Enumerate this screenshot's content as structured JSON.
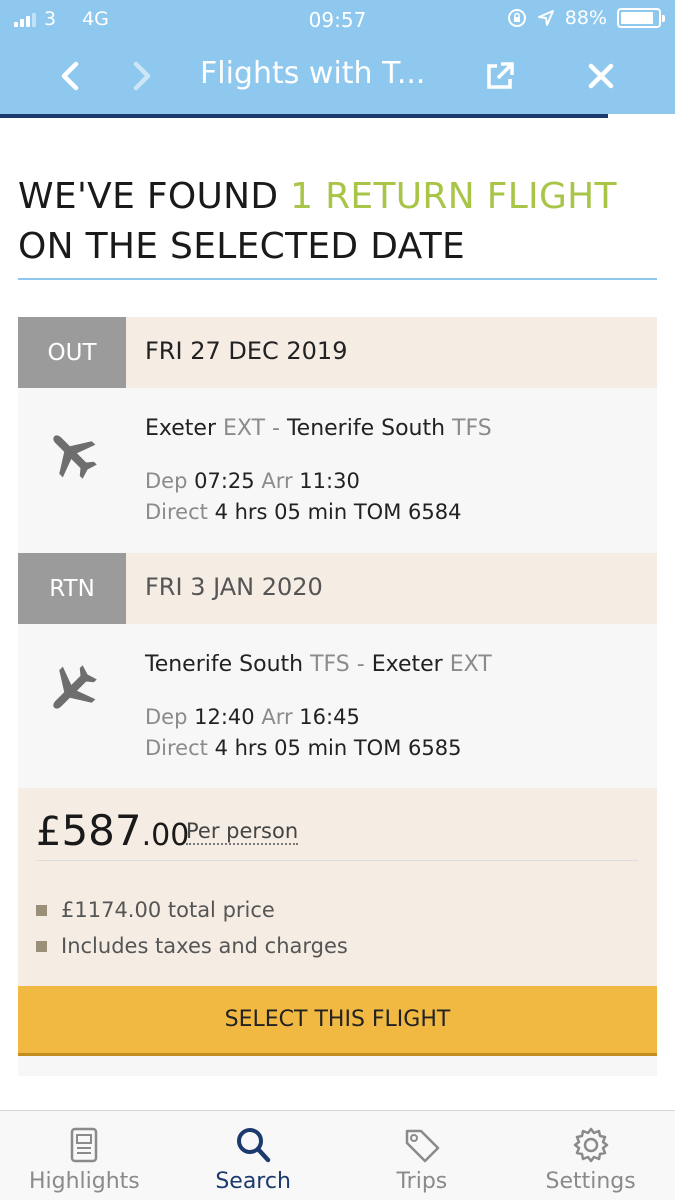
{
  "status_bar": {
    "carrier": "3",
    "network": "4G",
    "time": "09:57",
    "battery": "88%",
    "battery_level": 0.88
  },
  "nav": {
    "title": "Flights with T..."
  },
  "heading": {
    "line1_prefix": "We've found ",
    "line1_highlight": "1 return flight",
    "line2": "on the selected date"
  },
  "outbound": {
    "tag": "OUT",
    "date": "FRI 27 DEC 2019",
    "from": "Exeter",
    "from_code": "EXT",
    "separator": "-",
    "to": "Tenerife South",
    "to_code": "TFS",
    "dep_label": "Dep",
    "dep_time": "07:25",
    "arr_label": "Arr",
    "arr_time": "11:30",
    "type_label": "Direct",
    "duration": "4 hrs 05 min",
    "flight_no": "TOM 6584"
  },
  "return": {
    "tag": "RTN",
    "date": "FRI 3 JAN 2020",
    "from": "Tenerife South",
    "from_code": "TFS",
    "separator": "-",
    "to": "Exeter",
    "to_code": "EXT",
    "dep_label": "Dep",
    "dep_time": "12:40",
    "arr_label": "Arr",
    "arr_time": "16:45",
    "type_label": "Direct",
    "duration": "4 hrs 05 min",
    "flight_no": "TOM 6585"
  },
  "price": {
    "currency": "£",
    "whole": "587",
    "decimals": ".00",
    "per_person": "Per person",
    "bullets": [
      "£1174.00 total price",
      "Includes taxes and charges"
    ]
  },
  "select_button": "SELECT THIS FLIGHT",
  "tabs": [
    {
      "label": "Highlights",
      "icon": "highlights-icon",
      "active": false
    },
    {
      "label": "Search",
      "icon": "search-icon",
      "active": true
    },
    {
      "label": "Trips",
      "icon": "tag-icon",
      "active": false
    },
    {
      "label": "Settings",
      "icon": "gear-icon",
      "active": false
    }
  ],
  "colors": {
    "header": "#8ec8ee",
    "accent_green": "#a8c547",
    "navy": "#1c3a6e",
    "button": "#f1b941",
    "leg_header_bg": "#f5ede4"
  }
}
